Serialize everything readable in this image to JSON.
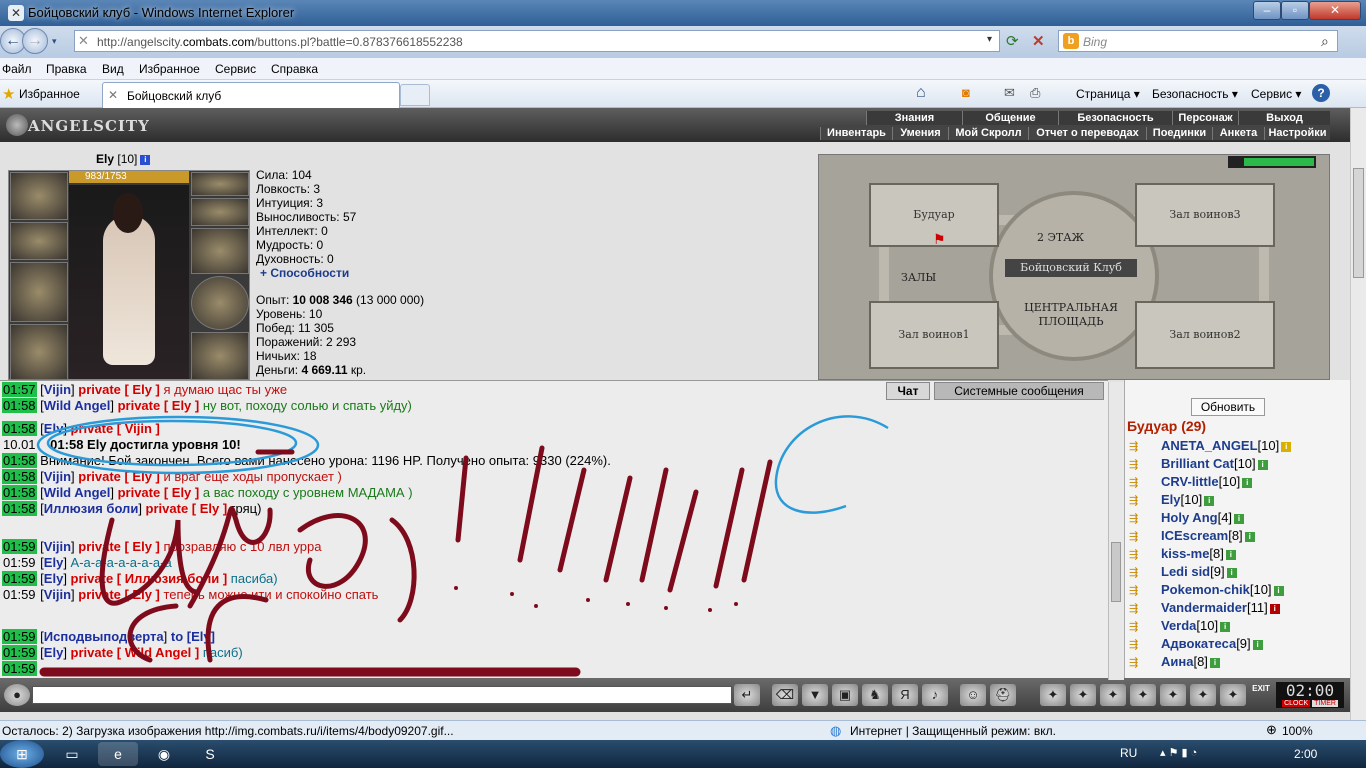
{
  "window": {
    "title": "Бойцовский клуб - Windows Internet Explorer"
  },
  "address": {
    "url_prefix": "http://angelscity.",
    "url_domain": "combats.com",
    "url_suffix": "/buttons.pl?battle=0.878376618552238",
    "search_placeholder": "Bing"
  },
  "menu": [
    "Файл",
    "Правка",
    "Вид",
    "Избранное",
    "Сервис",
    "Справка"
  ],
  "favorites": {
    "label": "Избранное",
    "tab": "Бойцовский клуб"
  },
  "commands": [
    "Страница ▾",
    "Безопасность ▾",
    "Сервис ▾"
  ],
  "game": {
    "logo": "ANGELSCITY",
    "nav_top": [
      "Знания",
      "Общение",
      "Безопасность",
      "Персонаж",
      "Выход"
    ],
    "nav_bottom": [
      "Инвентарь",
      "Умения",
      "Мой Скролл",
      "Отчет о переводах",
      "Поединки",
      "Анкета",
      "Настройки"
    ],
    "character": {
      "name": "Ely",
      "level": "[10]",
      "hp": "983/1753"
    },
    "stats": [
      "Сила: 104",
      "Ловкость: 3",
      "Интуиция: 3",
      "Выносливость: 57",
      "Интеллект: 0",
      "Мудрость: 0",
      "Духовность: 0"
    ],
    "abilities_link": "+ Способности",
    "progress": {
      "exp_label": "Опыт: ",
      "exp_value": "10 008 346",
      "exp_next": " (13 000 000)",
      "level": "Уровень: 10",
      "wins": "Побед: 11 305",
      "losses": "Поражений: 2 293",
      "draws": "Ничьих: 18",
      "money_label": "Деньги: ",
      "money_value": "4 669.11",
      "money_unit": " кр."
    },
    "map": {
      "rooms": [
        "Будуар",
        "Зал воинов3",
        "Зал воинов1",
        "Зал воинов2"
      ],
      "floor": "2 ЭТАЖ",
      "club": "Бойцовский Клуб",
      "halls": "ЗАЛЫ",
      "central": "ЦЕНТРАЛЬНАЯ ПЛОЩАДЬ"
    },
    "chat_tabs": [
      "Чат",
      "Системные сообщения"
    ],
    "chat": [
      {
        "t": "01:57",
        "n": "Vijin",
        "p": "private [ Ely ]",
        "m": " я думаю щас ты уже ",
        "c": "pv"
      },
      {
        "t": "01:58",
        "n": "Wild Angel",
        "p": "private [ Ely ]",
        "m": " ну вот, походу солью и спать уйду)",
        "c": "gr"
      },
      {
        "t": "01:58",
        "n": "Ely",
        "p": "private [ Vijin ]",
        "m": "",
        "c": "tl"
      },
      {
        "t": "10.01",
        "n": "",
        "p": "",
        "m": "01:58 Ely достигла уровня 10!",
        "c": "sys"
      },
      {
        "t": "01:58",
        "n": "",
        "p": "",
        "m": "Внимание! Бой закончен. Всего вами нанесено урона: 1196 HP. Получено опыта: 9330 (224%).",
        "c": "warn"
      },
      {
        "t": "01:58",
        "n": "Vijin",
        "p": "private [ Ely ]",
        "m": " и враг еще ходы пропускает )",
        "c": "pv"
      },
      {
        "t": "01:58",
        "n": "Wild Angel",
        "p": "private [ Ely ]",
        "m": " а вас походу с уровнем МАДАМА )",
        "c": "gr"
      },
      {
        "t": "01:58",
        "n": "Иллюзия боли",
        "p": "private [ Ely ]",
        "m": " гряц)",
        "c": "plain"
      },
      {
        "t": "01:59",
        "n": "Vijin",
        "p": "private [ Ely ]",
        "m": " прозравляю с 10 лвл урра",
        "c": "pv"
      },
      {
        "t": "01:59",
        "n": "Ely",
        "p": "",
        "m": " А-а-а-а-а-а-а-а-а",
        "c": "tl"
      },
      {
        "t": "01:59",
        "n": "Ely",
        "p": "private [ Иллюзия боли ]",
        "m": " пасиба)",
        "c": "tl"
      },
      {
        "t": "01:59",
        "n": "Vijin",
        "p": "private [ Ely ]",
        "m": " теперь можно ити и спокойно спать",
        "c": "pv"
      },
      {
        "t": "01:59",
        "n": "Исподвыподверта",
        "p": "",
        "m": " to [Ely]",
        "c": "to"
      },
      {
        "t": "01:59",
        "n": "Ely",
        "p": "private [ Wild Angel ]",
        "m": " пасиб)",
        "c": "tl"
      },
      {
        "t": "01:59",
        "n": "",
        "p": "",
        "m": "",
        "c": "plain"
      }
    ],
    "online": {
      "refresh": "Обновить",
      "room": "Будуар (29)",
      "users": [
        {
          "name": "ANETA_ANGEL",
          "level": "[10]",
          "badge": "smy"
        },
        {
          "name": "Brilliant Cat",
          "level": "[10]",
          "badge": "sm"
        },
        {
          "name": "CRV-little",
          "level": "[10]",
          "badge": "sm"
        },
        {
          "name": "Ely",
          "level": "[10]",
          "badge": "sm"
        },
        {
          "name": "Holy Ang",
          "level": "[4]",
          "badge": "sm"
        },
        {
          "name": "ICEscream",
          "level": "[8]",
          "badge": "sm"
        },
        {
          "name": "kiss-me",
          "level": "[8]",
          "badge": "sm"
        },
        {
          "name": "Ledi sid",
          "level": "[9]",
          "badge": "sm"
        },
        {
          "name": "Pokemon-chik",
          "level": "[10]",
          "badge": "sm"
        },
        {
          "name": "Vandermaider",
          "level": "[11]",
          "badge": "smr"
        },
        {
          "name": "Verda",
          "level": "[10]",
          "badge": "sm"
        },
        {
          "name": "Адвокатеса",
          "level": "[9]",
          "badge": "sm"
        },
        {
          "name": "Аина",
          "level": "[8]",
          "badge": "sm"
        }
      ]
    },
    "clock": "02:00",
    "clock_labels": [
      "CLOCK",
      "TIMER"
    ],
    "exit": "EXIT"
  },
  "status": {
    "loading": "Осталось: 2) Загрузка изображения http://img.combats.ru/i/items/4/body09207.gif...",
    "zone": "Интернет | Защищенный режим: вкл.",
    "zoom": "100%"
  },
  "taskbar": {
    "lang": "RU",
    "time": "2:00"
  }
}
